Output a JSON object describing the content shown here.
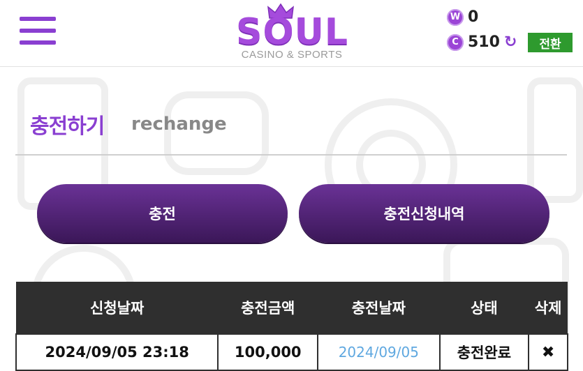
{
  "header": {
    "logo": {
      "word": "SOUL",
      "subtitle": "CASINO & SPORTS"
    },
    "wallet": {
      "w_icon": "W",
      "w_amount": "0",
      "c_icon": "C",
      "c_amount": "510",
      "refresh_icon": "refresh-icon",
      "convert_label": "전환"
    }
  },
  "page": {
    "title": "충전하기",
    "subtitle": "rechange"
  },
  "actions": {
    "charge_label": "충전",
    "history_label": "충전신청내역"
  },
  "table": {
    "headers": [
      "신청날짜",
      "충전금액",
      "충전날짜",
      "상태",
      "삭제"
    ],
    "rows": [
      {
        "request_date": "2024/09/05 23:18",
        "amount": "100,000",
        "charge_date": "2024/09/05",
        "status": "충전완료",
        "delete": "✖"
      }
    ]
  },
  "colors": {
    "accent": "#8a3fd1",
    "button_gradient_top": "#6a3296",
    "button_gradient_bottom": "#3b1758",
    "convert": "#2e9a2e",
    "table_header": "#2f2f2f",
    "link": "#5fa8e0"
  }
}
